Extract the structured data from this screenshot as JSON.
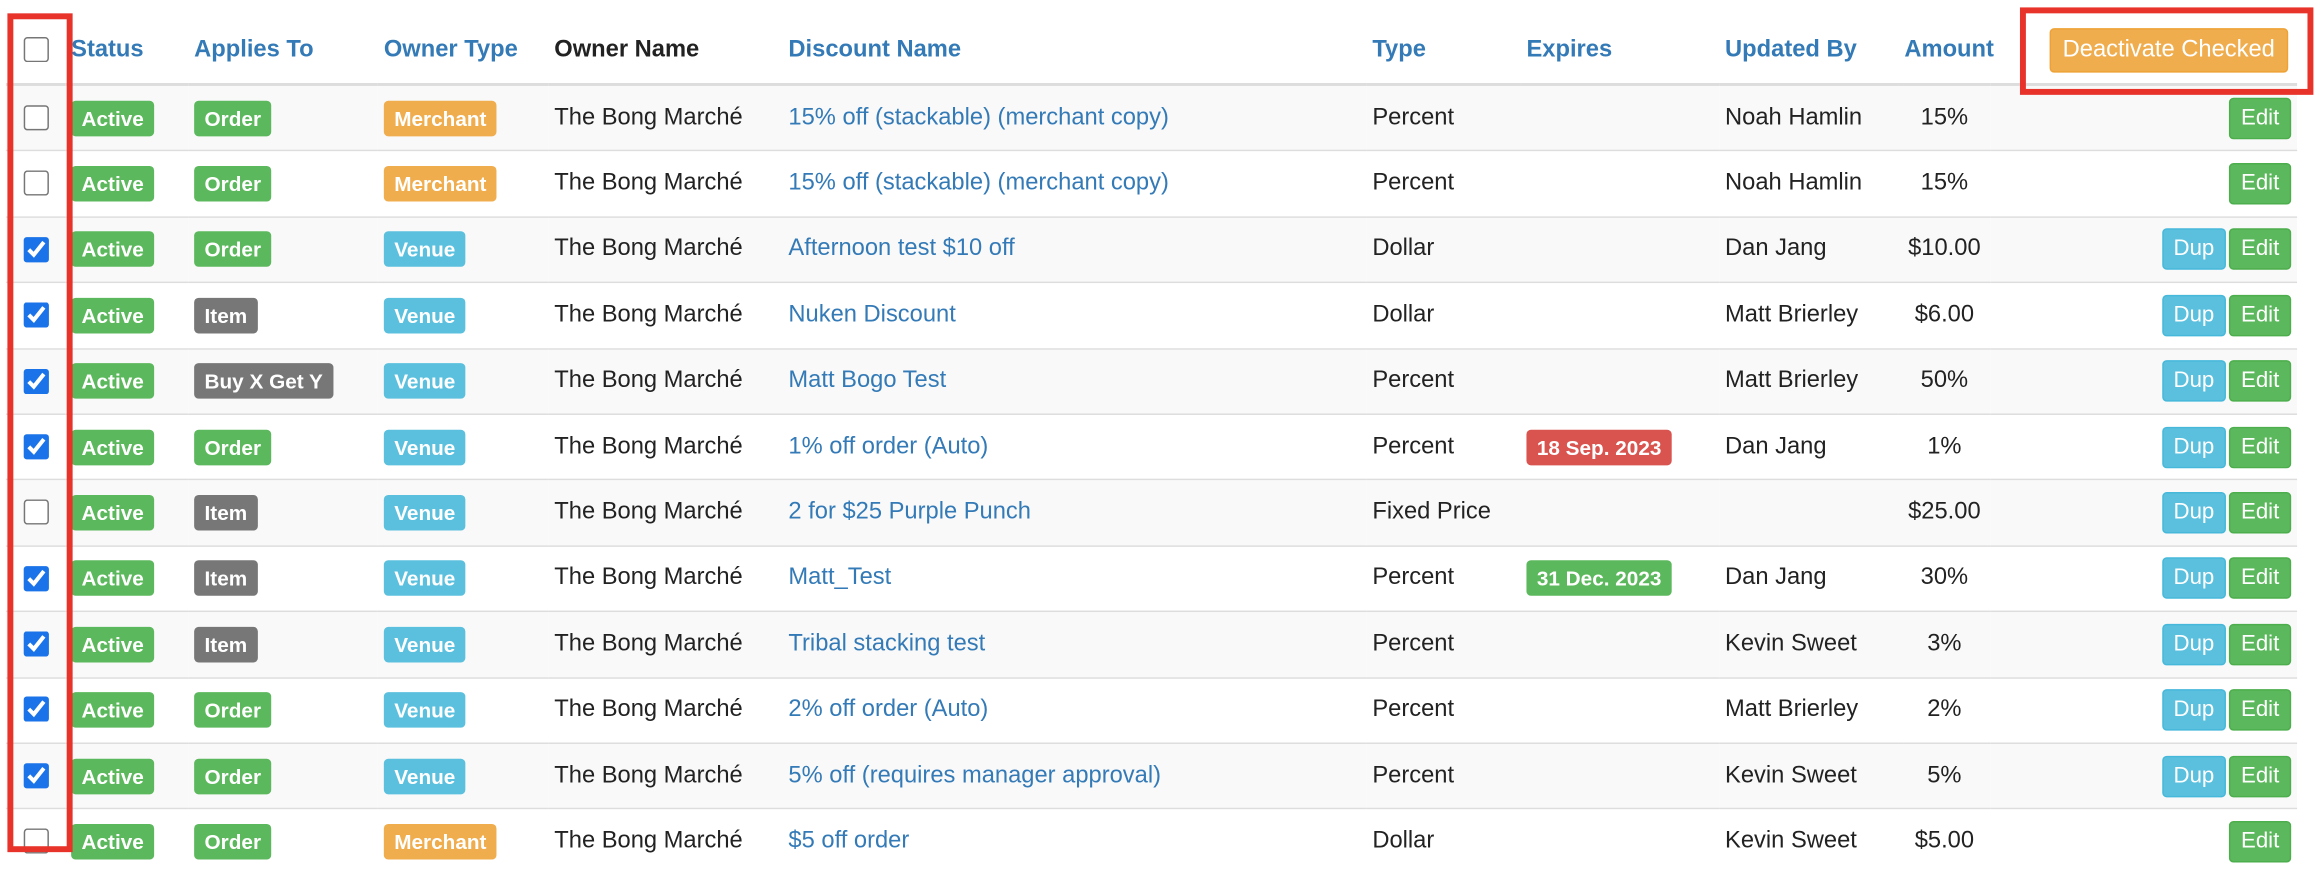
{
  "header": {
    "status": "Status",
    "applies_to": "Applies To",
    "owner_type": "Owner Type",
    "owner_name": "Owner Name",
    "discount_name": "Discount Name",
    "type": "Type",
    "expires": "Expires",
    "updated_by": "Updated By",
    "amount": "Amount",
    "deactivate_label": "Deactivate Checked"
  },
  "buttons": {
    "dup": "Dup",
    "edit": "Edit"
  },
  "label_colors": {
    "success": "#5cb85c",
    "default": "#777777",
    "warning": "#f0ad4e",
    "info": "#5bc0de",
    "danger": "#d9534f"
  },
  "highlight_color": "#e8332a",
  "rows": [
    {
      "checked": false,
      "status": "Active",
      "applies_to": "Order",
      "applies_style": "success",
      "owner_type": "Merchant",
      "owner_style": "warning",
      "owner_name": "The Bong Marché",
      "discount_name": "15% off (stackable) (merchant copy)",
      "type": "Percent",
      "expires": "",
      "expires_style": "",
      "updated_by": "Noah Hamlin",
      "amount": "15%",
      "dup": false
    },
    {
      "checked": false,
      "status": "Active",
      "applies_to": "Order",
      "applies_style": "success",
      "owner_type": "Merchant",
      "owner_style": "warning",
      "owner_name": "The Bong Marché",
      "discount_name": "15% off (stackable) (merchant copy)",
      "type": "Percent",
      "expires": "",
      "expires_style": "",
      "updated_by": "Noah Hamlin",
      "amount": "15%",
      "dup": false
    },
    {
      "checked": true,
      "status": "Active",
      "applies_to": "Order",
      "applies_style": "success",
      "owner_type": "Venue",
      "owner_style": "info",
      "owner_name": "The Bong Marché",
      "discount_name": "Afternoon test $10 off",
      "type": "Dollar",
      "expires": "",
      "expires_style": "",
      "updated_by": "Dan Jang",
      "amount": "$10.00",
      "dup": true
    },
    {
      "checked": true,
      "status": "Active",
      "applies_to": "Item",
      "applies_style": "default",
      "owner_type": "Venue",
      "owner_style": "info",
      "owner_name": "The Bong Marché",
      "discount_name": "Nuken Discount",
      "type": "Dollar",
      "expires": "",
      "expires_style": "",
      "updated_by": "Matt Brierley",
      "amount": "$6.00",
      "dup": true
    },
    {
      "checked": true,
      "status": "Active",
      "applies_to": "Buy X Get Y",
      "applies_style": "default",
      "owner_type": "Venue",
      "owner_style": "info",
      "owner_name": "The Bong Marché",
      "discount_name": "Matt Bogo Test",
      "type": "Percent",
      "expires": "",
      "expires_style": "",
      "updated_by": "Matt Brierley",
      "amount": "50%",
      "dup": true
    },
    {
      "checked": true,
      "status": "Active",
      "applies_to": "Order",
      "applies_style": "success",
      "owner_type": "Venue",
      "owner_style": "info",
      "owner_name": "The Bong Marché",
      "discount_name": "1% off order (Auto)",
      "type": "Percent",
      "expires": "18 Sep. 2023",
      "expires_style": "danger",
      "updated_by": "Dan Jang",
      "amount": "1%",
      "dup": true
    },
    {
      "checked": false,
      "status": "Active",
      "applies_to": "Item",
      "applies_style": "default",
      "owner_type": "Venue",
      "owner_style": "info",
      "owner_name": "The Bong Marché",
      "discount_name": "2 for $25 Purple Punch",
      "type": "Fixed Price",
      "expires": "",
      "expires_style": "",
      "updated_by": "",
      "amount": "$25.00",
      "dup": true
    },
    {
      "checked": true,
      "status": "Active",
      "applies_to": "Item",
      "applies_style": "default",
      "owner_type": "Venue",
      "owner_style": "info",
      "owner_name": "The Bong Marché",
      "discount_name": "Matt_Test",
      "type": "Percent",
      "expires": "31 Dec. 2023",
      "expires_style": "success",
      "updated_by": "Dan Jang",
      "amount": "30%",
      "dup": true
    },
    {
      "checked": true,
      "status": "Active",
      "applies_to": "Item",
      "applies_style": "default",
      "owner_type": "Venue",
      "owner_style": "info",
      "owner_name": "The Bong Marché",
      "discount_name": "Tribal stacking test",
      "type": "Percent",
      "expires": "",
      "expires_style": "",
      "updated_by": "Kevin Sweet",
      "amount": "3%",
      "dup": true
    },
    {
      "checked": true,
      "status": "Active",
      "applies_to": "Order",
      "applies_style": "success",
      "owner_type": "Venue",
      "owner_style": "info",
      "owner_name": "The Bong Marché",
      "discount_name": "2% off order (Auto)",
      "type": "Percent",
      "expires": "",
      "expires_style": "",
      "updated_by": "Matt Brierley",
      "amount": "2%",
      "dup": true
    },
    {
      "checked": true,
      "status": "Active",
      "applies_to": "Order",
      "applies_style": "success",
      "owner_type": "Venue",
      "owner_style": "info",
      "owner_name": "The Bong Marché",
      "discount_name": "5% off (requires manager approval)",
      "type": "Percent",
      "expires": "",
      "expires_style": "",
      "updated_by": "Kevin Sweet",
      "amount": "5%",
      "dup": true
    },
    {
      "checked": false,
      "status": "Active",
      "applies_to": "Order",
      "applies_style": "success",
      "owner_type": "Merchant",
      "owner_style": "warning",
      "owner_name": "The Bong Marché",
      "discount_name": "$5 off order",
      "type": "Dollar",
      "expires": "",
      "expires_style": "",
      "updated_by": "Kevin Sweet",
      "amount": "$5.00",
      "dup": false
    }
  ]
}
